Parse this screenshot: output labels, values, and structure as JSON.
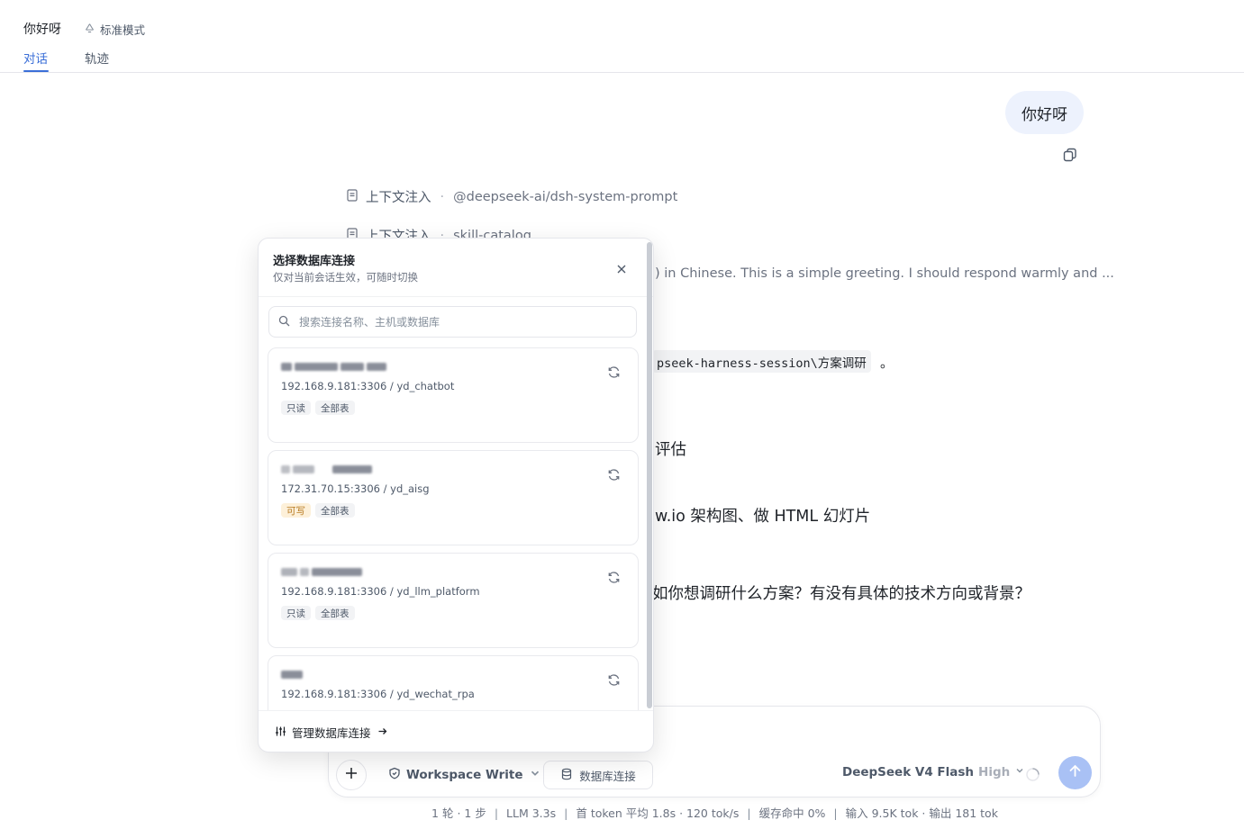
{
  "header": {
    "title": "你好呀",
    "mode_label": "标准模式",
    "tabs": [
      {
        "label": "对话",
        "active": true
      },
      {
        "label": "轨迹",
        "active": false
      }
    ]
  },
  "chat": {
    "user_message": "你好呀",
    "context_rows": [
      {
        "label": "上下文注入",
        "target": "@deepseek-ai/dsh-system-prompt"
      },
      {
        "label": "上下文注入",
        "target": "skill-catalog"
      }
    ],
    "thinking_fragment": ") in Chinese. This is a simple greeting. I should respond warmly and ...",
    "code_fragment": "pseek-harness-session\\方案调研",
    "code_tail": "。",
    "body_lines": [
      "评估",
      "w.io 架构图、做 HTML 幻灯片",
      "如你想调研什么方案？有没有具体的技术方向或背景？"
    ]
  },
  "composer": {
    "workspace_label": "Workspace Write",
    "db_button_label": "数据库连接",
    "model_name": "DeepSeek V4 Flash",
    "model_level": "High"
  },
  "stats": {
    "rounds": "1 轮 · 1 步",
    "llm": "LLM 3.3s",
    "first_token": "首 token 平均 1.8s · 120 tok/s",
    "cache": "缓存命中 0%",
    "io": "输入 9.5K tok · 输出 181 tok"
  },
  "db_popover": {
    "title": "选择数据库连接",
    "subtitle": "仅对当前会话生效，可随时切换",
    "search_placeholder": "搜索连接名称、主机或数据库",
    "connections": [
      {
        "address": "192.168.9.181:3306 / yd_chatbot",
        "tags": [
          {
            "label": "只读",
            "kind": "readonly"
          },
          {
            "label": "全部表",
            "kind": "scope"
          }
        ]
      },
      {
        "address": "172.31.70.15:3306 / yd_aisg",
        "tags": [
          {
            "label": "可写",
            "kind": "write"
          },
          {
            "label": "全部表",
            "kind": "scope"
          }
        ]
      },
      {
        "address": "192.168.9.181:3306 / yd_llm_platform",
        "tags": [
          {
            "label": "只读",
            "kind": "readonly"
          },
          {
            "label": "全部表",
            "kind": "scope"
          }
        ]
      },
      {
        "address": "192.168.9.181:3306 / yd_wechat_rpa",
        "tags": []
      }
    ],
    "footer_label": "管理数据库连接"
  },
  "colors": {
    "accent": "#3b6fd8",
    "send_button": "#a9c1f5",
    "user_bubble": "#edf2fd",
    "write_tag_bg": "#fdf0d9",
    "write_tag_text": "#b7791f"
  }
}
